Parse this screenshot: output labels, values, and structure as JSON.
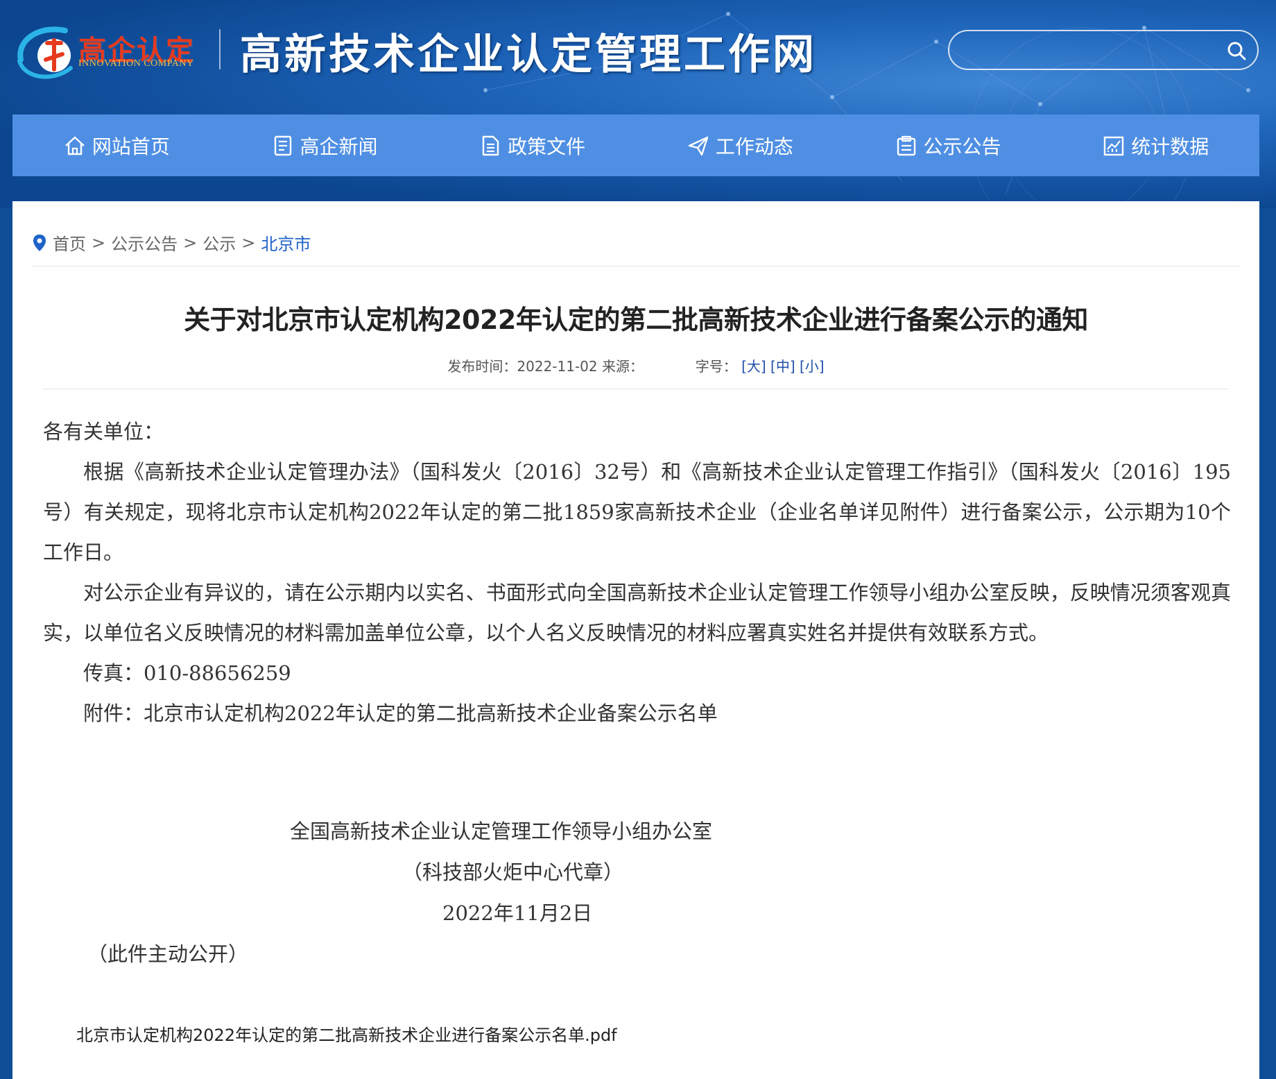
{
  "header": {
    "logo_cn": "高企认定",
    "logo_en": "INNOVATION COMPANY",
    "site_title": "高新技术企业认定管理工作网",
    "search_placeholder": ""
  },
  "nav": {
    "items": [
      {
        "label": "网站首页",
        "icon": "home-icon"
      },
      {
        "label": "高企新闻",
        "icon": "news-icon"
      },
      {
        "label": "政策文件",
        "icon": "document-icon"
      },
      {
        "label": "工作动态",
        "icon": "paper-plane-icon"
      },
      {
        "label": "公示公告",
        "icon": "clipboard-icon"
      },
      {
        "label": "统计数据",
        "icon": "chart-icon"
      }
    ]
  },
  "breadcrumb": {
    "items": [
      "首页",
      "公示公告",
      "公示",
      "北京市"
    ],
    "separator": ">"
  },
  "article": {
    "title": "关于对北京市认定机构2022年认定的第二批高新技术企业进行备案公示的通知",
    "publish_label": "发布时间：",
    "publish_date": "2022-11-02",
    "source_label": "来源：",
    "source_value": "",
    "font_size_label": "字号：",
    "size_large": "[大]",
    "size_medium": "[中]",
    "size_small": "[小]",
    "salutation": "各有关单位：",
    "para1": "根据《高新技术企业认定管理办法》（国科发火〔2016〕32号）和《高新技术企业认定管理工作指引》（国科发火〔2016〕195号）有关规定，现将北京市认定机构2022年认定的第二批1859家高新技术企业（企业名单详见附件）进行备案公示，公示期为10个工作日。",
    "para2": "对公示企业有异议的，请在公示期内以实名、书面形式向全国高新技术企业认定管理工作领导小组办公室反映，反映情况须客观真实，以单位名义反映情况的材料需加盖单位公章，以个人名义反映情况的材料应署真实姓名并提供有效联系方式。",
    "fax": "传真：010-88656259",
    "attachment_line": "附件：北京市认定机构2022年认定的第二批高新技术企业备案公示名单",
    "signature_org": "全国高新技术企业认定管理工作领导小组办公室",
    "signature_seal": "（科技部火炬中心代章）",
    "signature_date": "2022年11月2日",
    "public_note": "（此件主动公开）",
    "attachment_file": "北京市认定机构2022年认定的第二批高新技术企业进行备案公示名单.pdf"
  },
  "colors": {
    "header_bg": "#0f4d96",
    "nav_bg": "#4f8fe3",
    "breadcrumb_current": "#1f63c9",
    "logo_red": "#e53a1e",
    "logo_gold": "#f6c04a"
  }
}
